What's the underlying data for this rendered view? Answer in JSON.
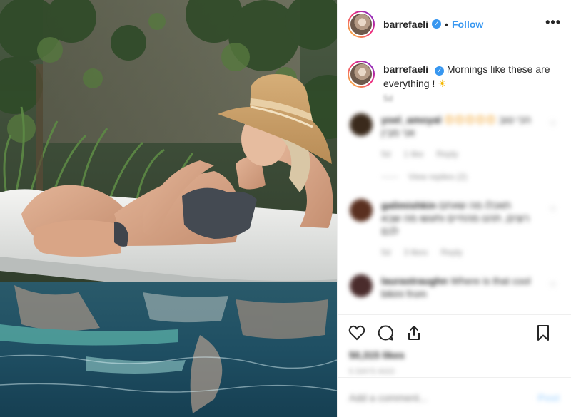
{
  "post": {
    "photo_alt": "Woman in straw hat and scalloped bikini lounging on a white pool float",
    "username": "barrefaeli",
    "verified_mark": "✓",
    "separator": "•",
    "follow_label": "Follow",
    "more_label": "•••"
  },
  "caption": {
    "username": "barrefaeli",
    "text": "Mornings like these are everything !",
    "emoji": "☀",
    "time": "5d"
  },
  "comments": [
    {
      "username": "yoel_amoyal",
      "text": "הכי טוב אני מבין",
      "emojis": "😍😍😍😍😍",
      "time": "5d",
      "likes": "1 like",
      "reply": "Reply",
      "view_replies": "View replies (2)",
      "heart": "♡",
      "avatar_color": "#3a2a1c"
    },
    {
      "username": "galimishkin",
      "text": "תאכלו מה שאתם רוצים, תהנו מהחיים ותעשו מה שבא לכם",
      "time": "5d",
      "likes": "3 likes",
      "reply": "Reply",
      "heart": "♡",
      "avatar_color": "#5a3020"
    },
    {
      "username": "laurastraughn",
      "text": "Where is that cool bikini from",
      "time": "",
      "heart": "♡",
      "avatar_color": "#4a2c2c"
    }
  ],
  "actions": {
    "likes": "50,315 likes",
    "time_ago": "5 DAYS AGO",
    "add_comment_placeholder": "Add a comment...",
    "post_label": "Post"
  },
  "colors": {
    "accent": "#3897f0",
    "text": "#262626",
    "muted": "#8e8e8e",
    "border": "#efefef"
  }
}
